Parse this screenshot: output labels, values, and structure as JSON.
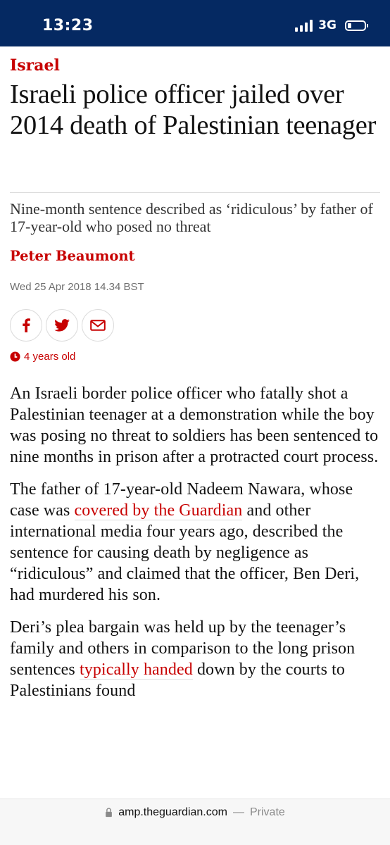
{
  "status_bar": {
    "time": "13:23",
    "network": "3G",
    "icons": [
      "signal-bars-icon",
      "battery-icon"
    ]
  },
  "article": {
    "section": "Israel",
    "headline": "Israeli police officer jailed over 2014 death of Palestinian teenager",
    "standfirst": "Nine-month sentence described as ‘ridiculous’ by father of 17-year-old who posed no threat",
    "byline": "Peter Beaumont",
    "dateline": "Wed 25 Apr 2018 14.34 BST",
    "share_icons": [
      "facebook-icon",
      "twitter-icon",
      "email-icon"
    ],
    "age_warning": "4 years old",
    "paragraphs": [
      {
        "text": "An Israeli border police officer who fatally shot a Palestinian teenager at a demonstration while the boy was posing no threat to soldiers has been sentenced to nine months in prison after a protracted court process."
      },
      {
        "before": "The father of 17-year-old Nadeem Nawara, whose case was ",
        "link": "covered by the Guardian",
        "after": " and other international media four years ago, described the sentence for causing death by negligence as “ridiculous” and claimed that the officer, Ben Deri, had murdered his son."
      },
      {
        "before": "Deri’s plea bargain was held up by the teenager’s family and others in comparison to the long prison sentences ",
        "link": "typically handed",
        "after": " down by the courts to Palestinians found"
      }
    ]
  },
  "url_bar": {
    "domain": "amp.theguardian.com",
    "separator": "—",
    "mode": "Private"
  },
  "colors": {
    "status_bar_bg": "#052962",
    "accent_red": "#c70000",
    "text": "#121212"
  }
}
